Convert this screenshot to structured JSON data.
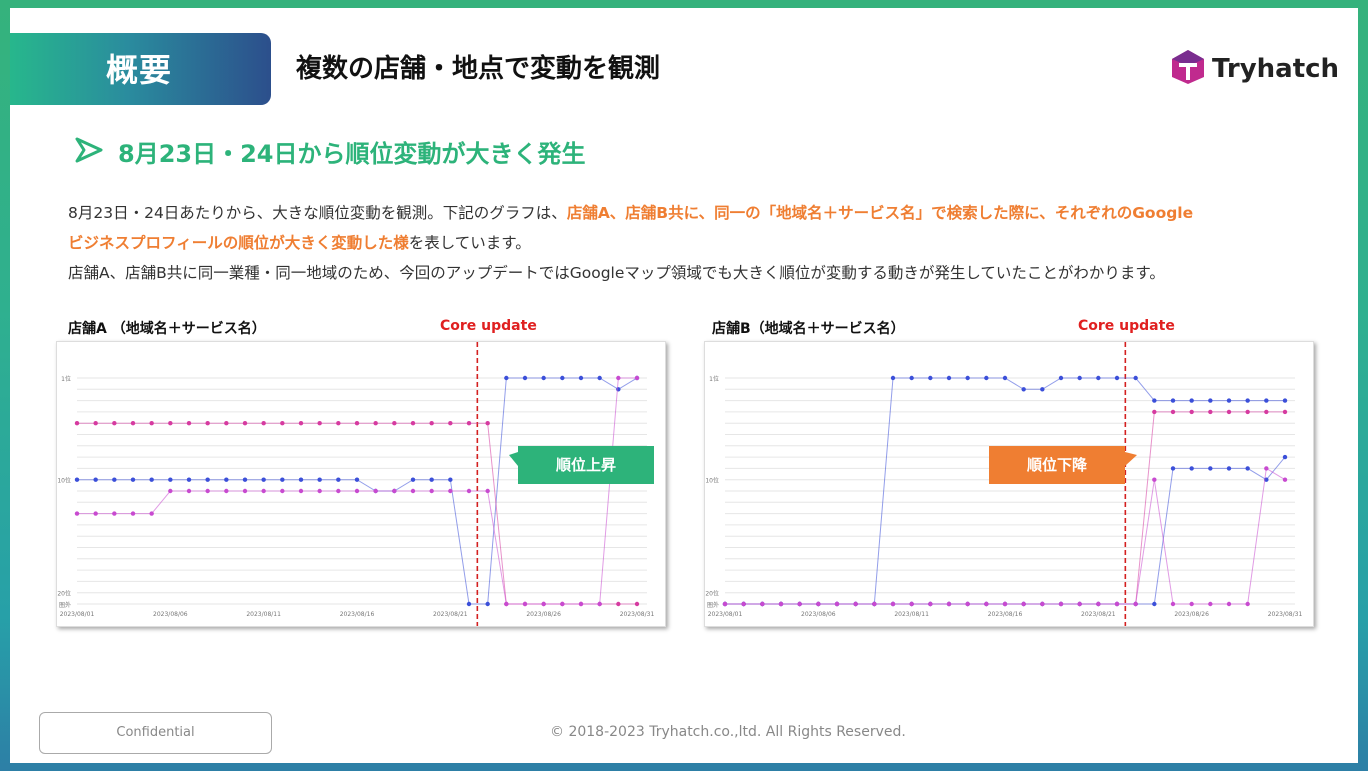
{
  "header": {
    "tag": "概要",
    "title": "複数の店舗・地点で変動を観測",
    "logo_text": "Tryhatch"
  },
  "section": {
    "heading": "8月23日・24日から順位変動が大きく発生"
  },
  "body": {
    "p1_a": "8月23日・24日あたりから、大きな順位変動を観測。下記のグラフは、",
    "p1_b": "店舗A、店舗B共に、同一の「地域名＋サービス名」で検索した際に、それぞれのGoogle",
    "p1_c": "ビジネスプロフィールの順位が大きく変動した様",
    "p1_d": "を表しています。",
    "p2": "店舗A、店舗B共に同一業種・同一地域のため、今回のアップデートではGoogleマップ領域でも大きく順位が変動する動きが発生していたことがわかります。"
  },
  "chart_data": [
    {
      "type": "line",
      "title": "店舗A （地域名＋サービス名）",
      "annotation": "Core update",
      "callout": "順位上昇",
      "y_tick_labels": [
        "1位",
        "10位",
        "20位",
        "圏外"
      ],
      "y_scale": "rank (inverted, 1 at top)",
      "x_tick_labels": [
        "2023/08/01",
        "2023/08/06",
        "2023/08/11",
        "2023/08/16",
        "2023/08/21",
        "2023/08/26",
        "2023/08/31"
      ],
      "update_index": 22,
      "series": [
        {
          "color": "#3b4fd9",
          "values": [
            10,
            10,
            10,
            10,
            10,
            10,
            10,
            10,
            10,
            10,
            10,
            10,
            10,
            10,
            10,
            10,
            11,
            11,
            10,
            10,
            10,
            21,
            21,
            1,
            1,
            1,
            1,
            1,
            1,
            2,
            1
          ]
        },
        {
          "color": "#d63aa0",
          "values": [
            5,
            5,
            5,
            5,
            5,
            5,
            5,
            5,
            5,
            5,
            5,
            5,
            5,
            5,
            5,
            5,
            5,
            5,
            5,
            5,
            5,
            5,
            5,
            21,
            21,
            21,
            21,
            21,
            21,
            21,
            21
          ]
        },
        {
          "color": "#c84ad0",
          "values": [
            13,
            13,
            13,
            13,
            13,
            11,
            11,
            11,
            11,
            11,
            11,
            11,
            11,
            11,
            11,
            11,
            11,
            11,
            11,
            11,
            11,
            11,
            11,
            21,
            21,
            21,
            21,
            21,
            21,
            1,
            1
          ]
        }
      ]
    },
    {
      "type": "line",
      "title": "店舗B（地域名＋サービス名）",
      "annotation": "Core update",
      "callout": "順位下降",
      "y_tick_labels": [
        "1位",
        "10位",
        "20位",
        "圏外"
      ],
      "y_scale": "rank (inverted, 1 at top)",
      "x_tick_labels": [
        "2023/08/01",
        "2023/08/06",
        "2023/08/11",
        "2023/08/16",
        "2023/08/21",
        "2023/08/26",
        "2023/08/31"
      ],
      "update_index": 22,
      "series": [
        {
          "color": "#3b4fd9",
          "values": [
            21,
            21,
            21,
            21,
            21,
            21,
            21,
            21,
            21,
            1,
            1,
            1,
            1,
            1,
            1,
            1,
            2,
            2,
            1,
            1,
            1,
            1,
            1,
            3,
            3,
            3,
            3,
            3,
            3,
            3,
            3
          ]
        },
        {
          "color": "#d63aa0",
          "values": [
            21,
            21,
            21,
            21,
            21,
            21,
            21,
            21,
            21,
            21,
            21,
            21,
            21,
            21,
            21,
            21,
            21,
            21,
            21,
            21,
            21,
            21,
            21,
            4,
            4,
            4,
            4,
            4,
            4,
            4,
            4
          ]
        },
        {
          "color": "#3b4fd9",
          "values": [
            21,
            21,
            21,
            21,
            21,
            21,
            21,
            21,
            21,
            21,
            21,
            21,
            21,
            21,
            21,
            21,
            21,
            21,
            21,
            21,
            21,
            21,
            21,
            21,
            9,
            9,
            9,
            9,
            9,
            10,
            8
          ]
        },
        {
          "color": "#c84ad0",
          "values": [
            21,
            21,
            21,
            21,
            21,
            21,
            21,
            21,
            21,
            21,
            21,
            21,
            21,
            21,
            21,
            21,
            21,
            21,
            21,
            21,
            21,
            21,
            21,
            10,
            21,
            21,
            21,
            21,
            21,
            9,
            10
          ]
        }
      ]
    }
  ],
  "footer": {
    "confidential": "Confidential",
    "copyright": "© 2018-2023 Tryhatch.co.,ltd. All Rights Reserved."
  }
}
